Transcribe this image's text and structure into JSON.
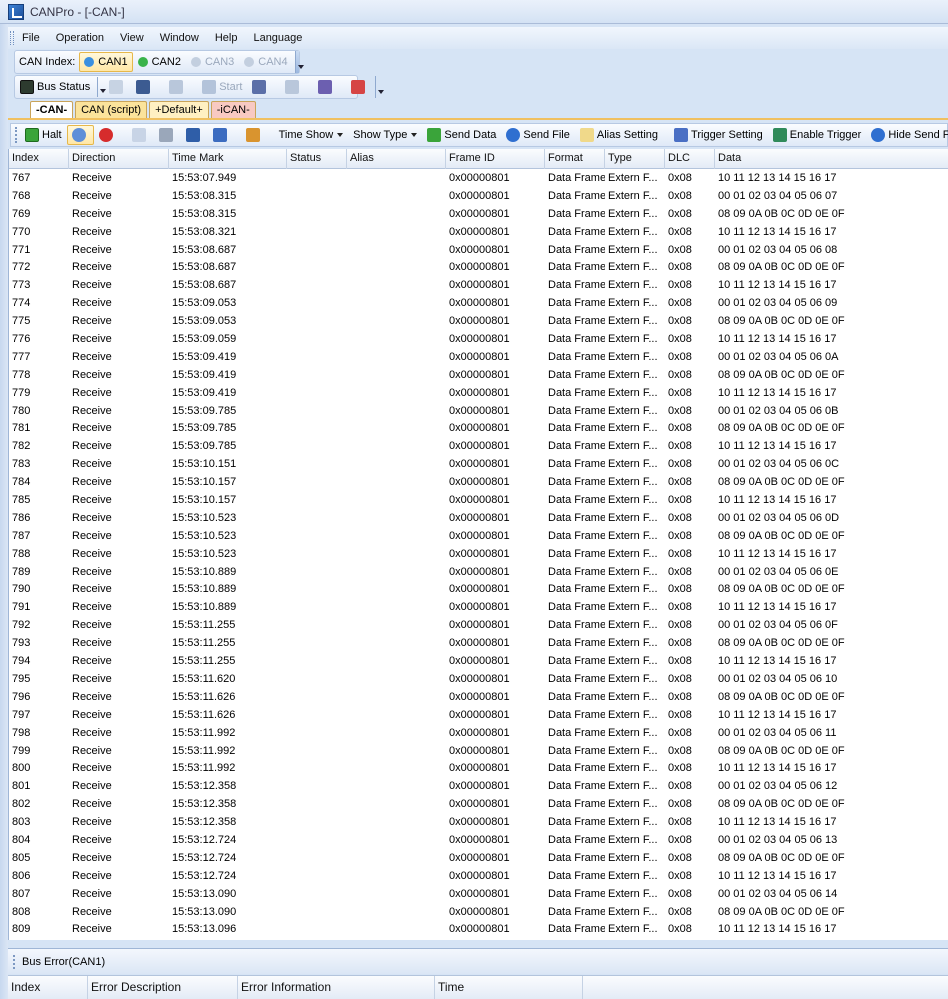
{
  "window": {
    "title": "CANPro - [-CAN-]"
  },
  "menu": [
    "File",
    "Operation",
    "View",
    "Window",
    "Help",
    "Language"
  ],
  "can_index": {
    "label": "CAN Index:",
    "channels": [
      {
        "label": "CAN1",
        "color": "#3a8fe0",
        "enabled": true,
        "selected": true
      },
      {
        "label": "CAN2",
        "color": "#3ab34a",
        "enabled": true,
        "selected": false
      },
      {
        "label": "CAN3",
        "color": "#b9c7d8",
        "enabled": false,
        "selected": false
      },
      {
        "label": "CAN4",
        "color": "#b9c7d8",
        "enabled": false,
        "selected": false
      }
    ]
  },
  "toolbar2": {
    "bus_status": "Bus Status",
    "start": "Start"
  },
  "tabs": [
    "-CAN-",
    "CAN (script)",
    "+Default+",
    "-iCAN-"
  ],
  "toolbar3": {
    "halt": "Halt",
    "time_show": "Time Show",
    "show_type": "Show Type",
    "send_data": "Send Data",
    "send_file": "Send File",
    "alias_setting": "Alias Setting",
    "trigger_setting": "Trigger Setting",
    "enable_trigger": "Enable Trigger",
    "hide_send_frame": "Hide Send Frame"
  },
  "grid": {
    "columns": [
      "Index",
      "Direction",
      "Time Mark",
      "Status",
      "Alias",
      "Frame ID",
      "Format",
      "Type",
      "DLC",
      "Data"
    ],
    "rows": [
      [
        "767",
        "Receive",
        "15:53:07.949",
        "",
        "",
        "0x00000801",
        "Data Frame",
        "Extern F...",
        "0x08",
        "10 11 12 13 14 15 16 17"
      ],
      [
        "768",
        "Receive",
        "15:53:08.315",
        "",
        "",
        "0x00000801",
        "Data Frame",
        "Extern F...",
        "0x08",
        "00 01 02 03 04 05 06 07"
      ],
      [
        "769",
        "Receive",
        "15:53:08.315",
        "",
        "",
        "0x00000801",
        "Data Frame",
        "Extern F...",
        "0x08",
        "08 09 0A 0B 0C 0D 0E 0F"
      ],
      [
        "770",
        "Receive",
        "15:53:08.321",
        "",
        "",
        "0x00000801",
        "Data Frame",
        "Extern F...",
        "0x08",
        "10 11 12 13 14 15 16 17"
      ],
      [
        "771",
        "Receive",
        "15:53:08.687",
        "",
        "",
        "0x00000801",
        "Data Frame",
        "Extern F...",
        "0x08",
        "00 01 02 03 04 05 06 08"
      ],
      [
        "772",
        "Receive",
        "15:53:08.687",
        "",
        "",
        "0x00000801",
        "Data Frame",
        "Extern F...",
        "0x08",
        "08 09 0A 0B 0C 0D 0E 0F"
      ],
      [
        "773",
        "Receive",
        "15:53:08.687",
        "",
        "",
        "0x00000801",
        "Data Frame",
        "Extern F...",
        "0x08",
        "10 11 12 13 14 15 16 17"
      ],
      [
        "774",
        "Receive",
        "15:53:09.053",
        "",
        "",
        "0x00000801",
        "Data Frame",
        "Extern F...",
        "0x08",
        "00 01 02 03 04 05 06 09"
      ],
      [
        "775",
        "Receive",
        "15:53:09.053",
        "",
        "",
        "0x00000801",
        "Data Frame",
        "Extern F...",
        "0x08",
        "08 09 0A 0B 0C 0D 0E 0F"
      ],
      [
        "776",
        "Receive",
        "15:53:09.059",
        "",
        "",
        "0x00000801",
        "Data Frame",
        "Extern F...",
        "0x08",
        "10 11 12 13 14 15 16 17"
      ],
      [
        "777",
        "Receive",
        "15:53:09.419",
        "",
        "",
        "0x00000801",
        "Data Frame",
        "Extern F...",
        "0x08",
        "00 01 02 03 04 05 06 0A"
      ],
      [
        "778",
        "Receive",
        "15:53:09.419",
        "",
        "",
        "0x00000801",
        "Data Frame",
        "Extern F...",
        "0x08",
        "08 09 0A 0B 0C 0D 0E 0F"
      ],
      [
        "779",
        "Receive",
        "15:53:09.419",
        "",
        "",
        "0x00000801",
        "Data Frame",
        "Extern F...",
        "0x08",
        "10 11 12 13 14 15 16 17"
      ],
      [
        "780",
        "Receive",
        "15:53:09.785",
        "",
        "",
        "0x00000801",
        "Data Frame",
        "Extern F...",
        "0x08",
        "00 01 02 03 04 05 06 0B"
      ],
      [
        "781",
        "Receive",
        "15:53:09.785",
        "",
        "",
        "0x00000801",
        "Data Frame",
        "Extern F...",
        "0x08",
        "08 09 0A 0B 0C 0D 0E 0F"
      ],
      [
        "782",
        "Receive",
        "15:53:09.785",
        "",
        "",
        "0x00000801",
        "Data Frame",
        "Extern F...",
        "0x08",
        "10 11 12 13 14 15 16 17"
      ],
      [
        "783",
        "Receive",
        "15:53:10.151",
        "",
        "",
        "0x00000801",
        "Data Frame",
        "Extern F...",
        "0x08",
        "00 01 02 03 04 05 06 0C"
      ],
      [
        "784",
        "Receive",
        "15:53:10.157",
        "",
        "",
        "0x00000801",
        "Data Frame",
        "Extern F...",
        "0x08",
        "08 09 0A 0B 0C 0D 0E 0F"
      ],
      [
        "785",
        "Receive",
        "15:53:10.157",
        "",
        "",
        "0x00000801",
        "Data Frame",
        "Extern F...",
        "0x08",
        "10 11 12 13 14 15 16 17"
      ],
      [
        "786",
        "Receive",
        "15:53:10.523",
        "",
        "",
        "0x00000801",
        "Data Frame",
        "Extern F...",
        "0x08",
        "00 01 02 03 04 05 06 0D"
      ],
      [
        "787",
        "Receive",
        "15:53:10.523",
        "",
        "",
        "0x00000801",
        "Data Frame",
        "Extern F...",
        "0x08",
        "08 09 0A 0B 0C 0D 0E 0F"
      ],
      [
        "788",
        "Receive",
        "15:53:10.523",
        "",
        "",
        "0x00000801",
        "Data Frame",
        "Extern F...",
        "0x08",
        "10 11 12 13 14 15 16 17"
      ],
      [
        "789",
        "Receive",
        "15:53:10.889",
        "",
        "",
        "0x00000801",
        "Data Frame",
        "Extern F...",
        "0x08",
        "00 01 02 03 04 05 06 0E"
      ],
      [
        "790",
        "Receive",
        "15:53:10.889",
        "",
        "",
        "0x00000801",
        "Data Frame",
        "Extern F...",
        "0x08",
        "08 09 0A 0B 0C 0D 0E 0F"
      ],
      [
        "791",
        "Receive",
        "15:53:10.889",
        "",
        "",
        "0x00000801",
        "Data Frame",
        "Extern F...",
        "0x08",
        "10 11 12 13 14 15 16 17"
      ],
      [
        "792",
        "Receive",
        "15:53:11.255",
        "",
        "",
        "0x00000801",
        "Data Frame",
        "Extern F...",
        "0x08",
        "00 01 02 03 04 05 06 0F"
      ],
      [
        "793",
        "Receive",
        "15:53:11.255",
        "",
        "",
        "0x00000801",
        "Data Frame",
        "Extern F...",
        "0x08",
        "08 09 0A 0B 0C 0D 0E 0F"
      ],
      [
        "794",
        "Receive",
        "15:53:11.255",
        "",
        "",
        "0x00000801",
        "Data Frame",
        "Extern F...",
        "0x08",
        "10 11 12 13 14 15 16 17"
      ],
      [
        "795",
        "Receive",
        "15:53:11.620",
        "",
        "",
        "0x00000801",
        "Data Frame",
        "Extern F...",
        "0x08",
        "00 01 02 03 04 05 06 10"
      ],
      [
        "796",
        "Receive",
        "15:53:11.626",
        "",
        "",
        "0x00000801",
        "Data Frame",
        "Extern F...",
        "0x08",
        "08 09 0A 0B 0C 0D 0E 0F"
      ],
      [
        "797",
        "Receive",
        "15:53:11.626",
        "",
        "",
        "0x00000801",
        "Data Frame",
        "Extern F...",
        "0x08",
        "10 11 12 13 14 15 16 17"
      ],
      [
        "798",
        "Receive",
        "15:53:11.992",
        "",
        "",
        "0x00000801",
        "Data Frame",
        "Extern F...",
        "0x08",
        "00 01 02 03 04 05 06 11"
      ],
      [
        "799",
        "Receive",
        "15:53:11.992",
        "",
        "",
        "0x00000801",
        "Data Frame",
        "Extern F...",
        "0x08",
        "08 09 0A 0B 0C 0D 0E 0F"
      ],
      [
        "800",
        "Receive",
        "15:53:11.992",
        "",
        "",
        "0x00000801",
        "Data Frame",
        "Extern F...",
        "0x08",
        "10 11 12 13 14 15 16 17"
      ],
      [
        "801",
        "Receive",
        "15:53:12.358",
        "",
        "",
        "0x00000801",
        "Data Frame",
        "Extern F...",
        "0x08",
        "00 01 02 03 04 05 06 12"
      ],
      [
        "802",
        "Receive",
        "15:53:12.358",
        "",
        "",
        "0x00000801",
        "Data Frame",
        "Extern F...",
        "0x08",
        "08 09 0A 0B 0C 0D 0E 0F"
      ],
      [
        "803",
        "Receive",
        "15:53:12.358",
        "",
        "",
        "0x00000801",
        "Data Frame",
        "Extern F...",
        "0x08",
        "10 11 12 13 14 15 16 17"
      ],
      [
        "804",
        "Receive",
        "15:53:12.724",
        "",
        "",
        "0x00000801",
        "Data Frame",
        "Extern F...",
        "0x08",
        "00 01 02 03 04 05 06 13"
      ],
      [
        "805",
        "Receive",
        "15:53:12.724",
        "",
        "",
        "0x00000801",
        "Data Frame",
        "Extern F...",
        "0x08",
        "08 09 0A 0B 0C 0D 0E 0F"
      ],
      [
        "806",
        "Receive",
        "15:53:12.724",
        "",
        "",
        "0x00000801",
        "Data Frame",
        "Extern F...",
        "0x08",
        "10 11 12 13 14 15 16 17"
      ],
      [
        "807",
        "Receive",
        "15:53:13.090",
        "",
        "",
        "0x00000801",
        "Data Frame",
        "Extern F...",
        "0x08",
        "00 01 02 03 04 05 06 14"
      ],
      [
        "808",
        "Receive",
        "15:53:13.090",
        "",
        "",
        "0x00000801",
        "Data Frame",
        "Extern F...",
        "0x08",
        "08 09 0A 0B 0C 0D 0E 0F"
      ],
      [
        "809",
        "Receive",
        "15:53:13.096",
        "",
        "",
        "0x00000801",
        "Data Frame",
        "Extern F...",
        "0x08",
        "10 11 12 13 14 15 16 17"
      ]
    ]
  },
  "bus_error_panel": {
    "title": "Bus Error(CAN1)",
    "columns": [
      "Index",
      "Error Description",
      "Error Information",
      "Time"
    ]
  }
}
